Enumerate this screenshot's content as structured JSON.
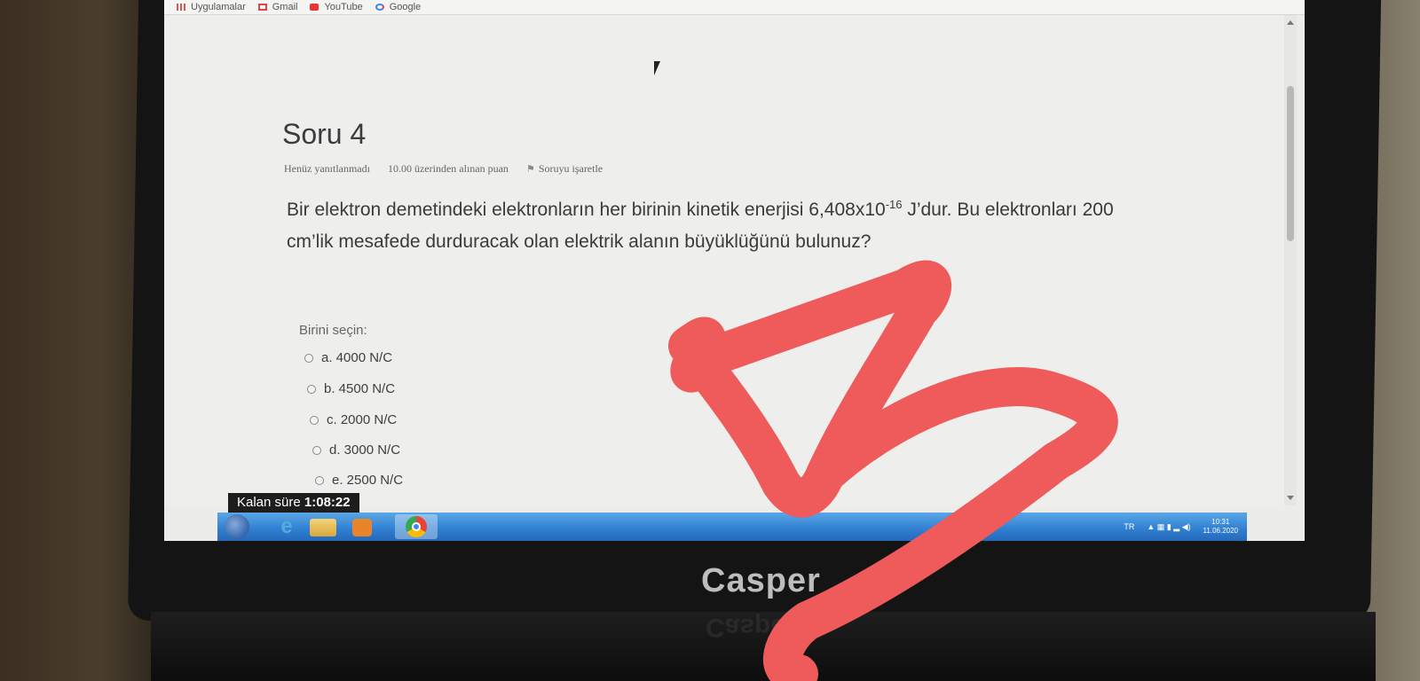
{
  "bookmarks": {
    "items": [
      {
        "label": "Uygulamalar",
        "icon": "apps-grid-icon"
      },
      {
        "label": "Gmail",
        "icon": "gmail-icon"
      },
      {
        "label": "YouTube",
        "icon": "youtube-icon"
      },
      {
        "label": "Google",
        "icon": "google-icon"
      }
    ]
  },
  "question": {
    "title": "Soru 4",
    "status": "Henüz yanıtlanmadı",
    "points": "10.00 üzerinden alınan puan",
    "flag_label": "Soruyu işaretle",
    "text_part1": "Bir elektron demetindeki elektronların her birinin kinetik enerjisi 6,408x10",
    "text_exponent": "-16",
    "text_part2": " J’dur. Bu elektronları 200 cm’lik mesafede durduracak olan elektrik alanın büyüklüğünü bulunuz?",
    "choose_label": "Birini seçin:",
    "options": [
      "a. 4000 N/C",
      "b. 4500 N/C",
      "c. 2000 N/C",
      "d. 3000 N/C",
      "e. 2500 N/C"
    ]
  },
  "timer": {
    "label": "Kalan süre",
    "value": "1:08:22"
  },
  "taskbar": {
    "language": "TR",
    "time": "10:31",
    "date": "11.06.2020"
  },
  "laptop": {
    "brand": "Casper"
  },
  "annotation": {
    "handwritten_letter": "B",
    "color": "#ef5a5a"
  }
}
